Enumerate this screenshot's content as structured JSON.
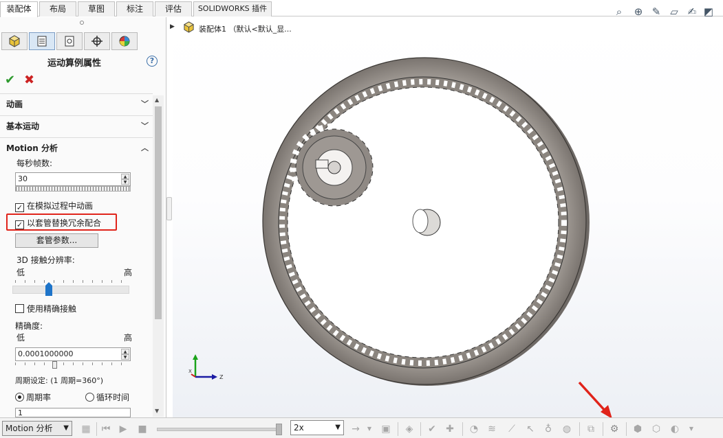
{
  "tabs": [
    "装配体",
    "布局",
    "草图",
    "标注",
    "评估",
    "SOLIDWORKS 插件"
  ],
  "panel": {
    "title": "运动算例属性",
    "tab_icons": [
      "assembly-icon",
      "property-icon",
      "config-icon",
      "target-icon",
      "appearance-icon"
    ],
    "sections": {
      "animation": "动画",
      "basic_motion": "基本运动",
      "motion_analysis": "Motion 分析"
    },
    "fps_label": "每秒帧数:",
    "fps_value": "30",
    "animate_during_sim": "在模拟过程中动画",
    "replace_redundant": "以套管替换冗余配合",
    "bushing_params_button": "套管参数...",
    "contact_res_label": "3D 接触分辨率:",
    "low": "低",
    "high": "高",
    "precise_contact": "使用精确接触",
    "accuracy_label": "精确度:",
    "accuracy_value": "0.0001000000",
    "cycle_label": "周期设定: (1 周期=360°)",
    "cycle_rate": "周期率",
    "cycle_time": "循环时间",
    "cycle_value": "1",
    "contact_resolution_level": 0.3
  },
  "tree": {
    "label": "装配体1 （默认<默认_显..."
  },
  "bottom": {
    "study_type": "Motion 分析",
    "speed": "2x"
  },
  "colors": {
    "highlight": "#e0231a",
    "gear": "#8f8984",
    "accent": "#1e74c9"
  }
}
